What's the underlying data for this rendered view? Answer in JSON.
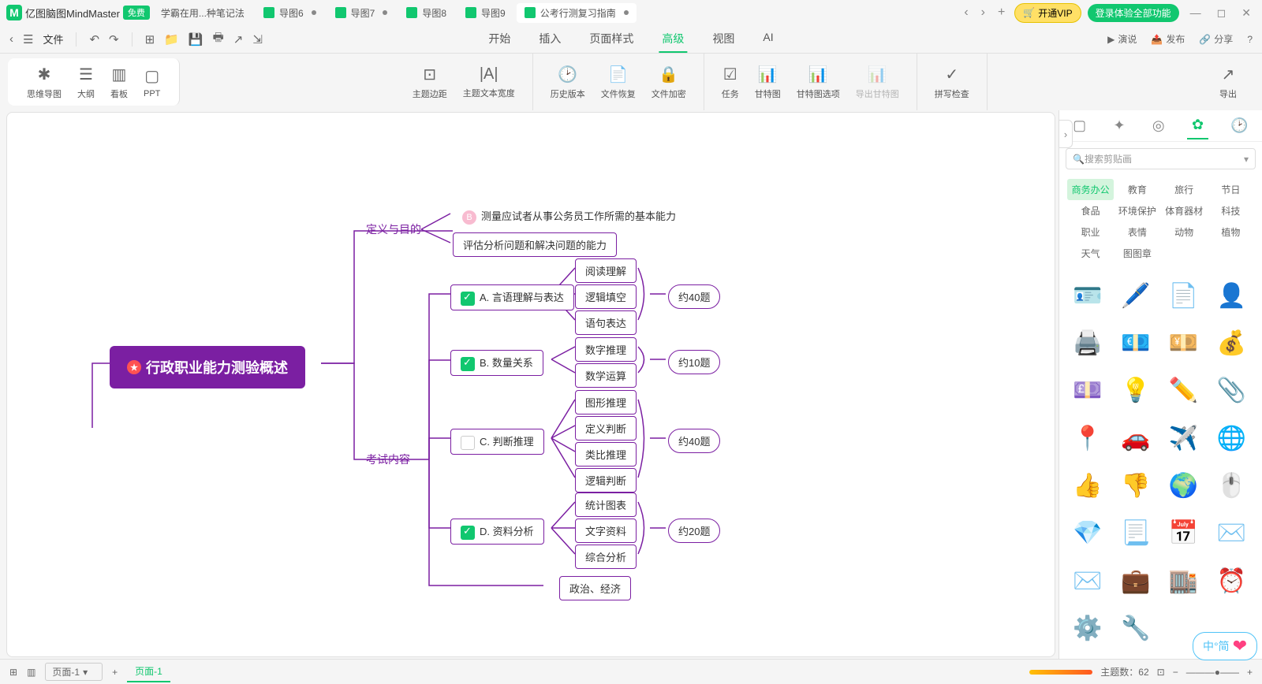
{
  "app": {
    "name": "亿图脑图MindMaster",
    "free": "免费"
  },
  "tabs": [
    {
      "label": "学霸在用...种笔记法"
    },
    {
      "label": "导图6"
    },
    {
      "label": "导图7"
    },
    {
      "label": "导图8"
    },
    {
      "label": "导图9"
    },
    {
      "label": "公考行测复习指南",
      "active": true
    }
  ],
  "titlebar": {
    "vip": "开通VIP",
    "login": "登录体验全部功能"
  },
  "menubar": {
    "file": "文件",
    "tabs": [
      "开始",
      "插入",
      "页面样式",
      "高级",
      "视图",
      "AI"
    ],
    "active": "高级",
    "right": [
      "演说",
      "发布",
      "分享"
    ]
  },
  "ribbon": {
    "view": [
      {
        "l": "思维导图"
      },
      {
        "l": "大纲"
      },
      {
        "l": "看板"
      },
      {
        "l": "PPT"
      }
    ],
    "theme": [
      {
        "l": "主题边距"
      },
      {
        "l": "主题文本宽度"
      }
    ],
    "file": [
      {
        "l": "历史版本"
      },
      {
        "l": "文件恢复"
      },
      {
        "l": "文件加密"
      }
    ],
    "task": [
      {
        "l": "任务"
      },
      {
        "l": "甘特图"
      },
      {
        "l": "甘特图选项"
      },
      {
        "l": "导出甘特图",
        "disabled": true
      }
    ],
    "spell": [
      {
        "l": "拼写检查"
      }
    ],
    "export": {
      "l": "导出"
    }
  },
  "mindmap": {
    "center": "行政职业能力测验概述",
    "branch1": "定义与目的",
    "b1n1": "测量应试者从事公务员工作所需的基本能力",
    "b1n1badge": "B",
    "b1n2": "评估分析问题和解决问题的能力",
    "branch2": "考试内容",
    "sA": "A. 言语理解与表达",
    "sA1": "阅读理解",
    "sA2": "逻辑填空",
    "sA3": "语句表达",
    "sAc": "约40题",
    "sB": "B. 数量关系",
    "sB1": "数字推理",
    "sB2": "数学运算",
    "sBc": "约10题",
    "sC": "C. 判断推理",
    "sC1": "图形推理",
    "sC2": "定义判断",
    "sC3": "类比推理",
    "sC4": "逻辑判断",
    "sCc": "约40题",
    "sD": "D. 资料分析",
    "sD1": "统计图表",
    "sD2": "文字资料",
    "sD3": "综合分析",
    "sDc": "约20题",
    "sE1": "政治、经济"
  },
  "side": {
    "search_ph": "搜索剪贴画",
    "cats": [
      "商务办公",
      "教育",
      "旅行",
      "节日",
      "食品",
      "环境保护",
      "体育器材",
      "科技",
      "职业",
      "表情",
      "动物",
      "植物",
      "天气",
      "图图章"
    ],
    "active_cat": "商务办公",
    "clips": [
      "🪪",
      "🖊️",
      "📄",
      "👤",
      "🖨️",
      "💶",
      "💴",
      "💰",
      "💷",
      "💡",
      "✏️",
      "📎",
      "📍",
      "🚗",
      "✈️",
      "🌐",
      "👍",
      "👎",
      "🌍",
      "🖱️",
      "💎",
      "📃",
      "📅",
      "✉️",
      "✉️",
      "💼",
      "🏬",
      "⏰",
      "⚙️",
      "🔧"
    ]
  },
  "status": {
    "page_sel": "页面-1",
    "page_tab": "页面-1",
    "topics_label": "主题数：",
    "topics": "62"
  },
  "ime": "中°简"
}
